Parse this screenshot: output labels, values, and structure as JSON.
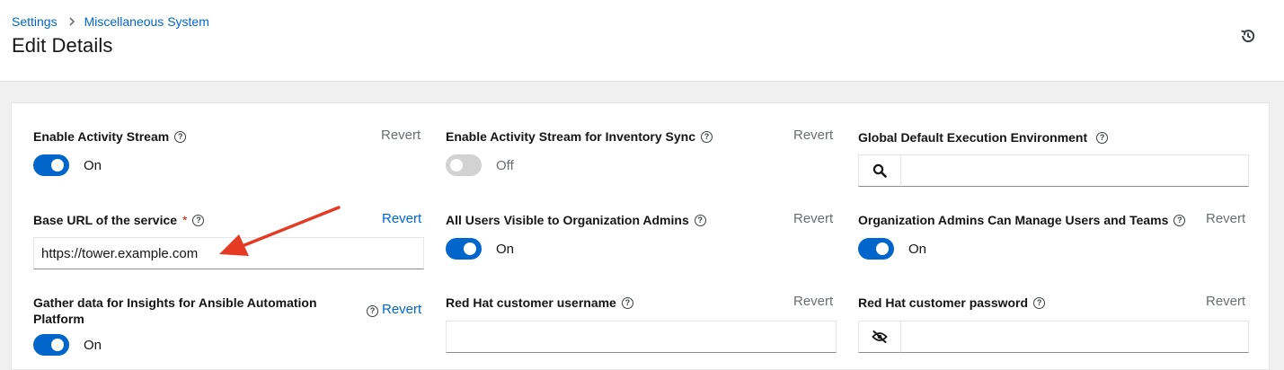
{
  "breadcrumb": {
    "root": "Settings",
    "current": "Miscellaneous System"
  },
  "page": {
    "title": "Edit Details"
  },
  "colors": {
    "link": "#0066cc",
    "toggle_on": "#0066cc",
    "toggle_off": "#d2d2d2",
    "required": "#c9190b",
    "arrow": "#e53a23"
  },
  "icons": {
    "history": "history-icon",
    "help": "help-icon",
    "search": "search-icon",
    "hide": "eye-slash-icon",
    "chevron": "chevron-right-icon"
  },
  "fields": {
    "activity_stream": {
      "label": "Enable Activity Stream",
      "revert": "Revert",
      "state": "On",
      "on": true
    },
    "activity_stream_inventory": {
      "label": "Enable Activity Stream for Inventory Sync",
      "revert": "Revert",
      "state": "Off",
      "on": false
    },
    "global_ee": {
      "label": "Global Default Execution Environment",
      "value": ""
    },
    "base_url": {
      "label": "Base URL of the service",
      "required": "*",
      "revert": "Revert",
      "value": "https://tower.example.com"
    },
    "users_visible": {
      "label": "All Users Visible to Organization Admins",
      "revert": "Revert",
      "state": "On",
      "on": true
    },
    "org_admins_manage": {
      "label": "Organization Admins Can Manage Users and Teams",
      "revert": "Revert",
      "state": "On",
      "on": true
    },
    "insights": {
      "label": "Gather data for Insights for Ansible Automation Platform",
      "revert": "Revert",
      "state": "On",
      "on": true
    },
    "rh_username": {
      "label": "Red Hat customer username",
      "revert": "Revert",
      "value": ""
    },
    "rh_password": {
      "label": "Red Hat customer password",
      "revert": "Revert",
      "value": ""
    }
  }
}
